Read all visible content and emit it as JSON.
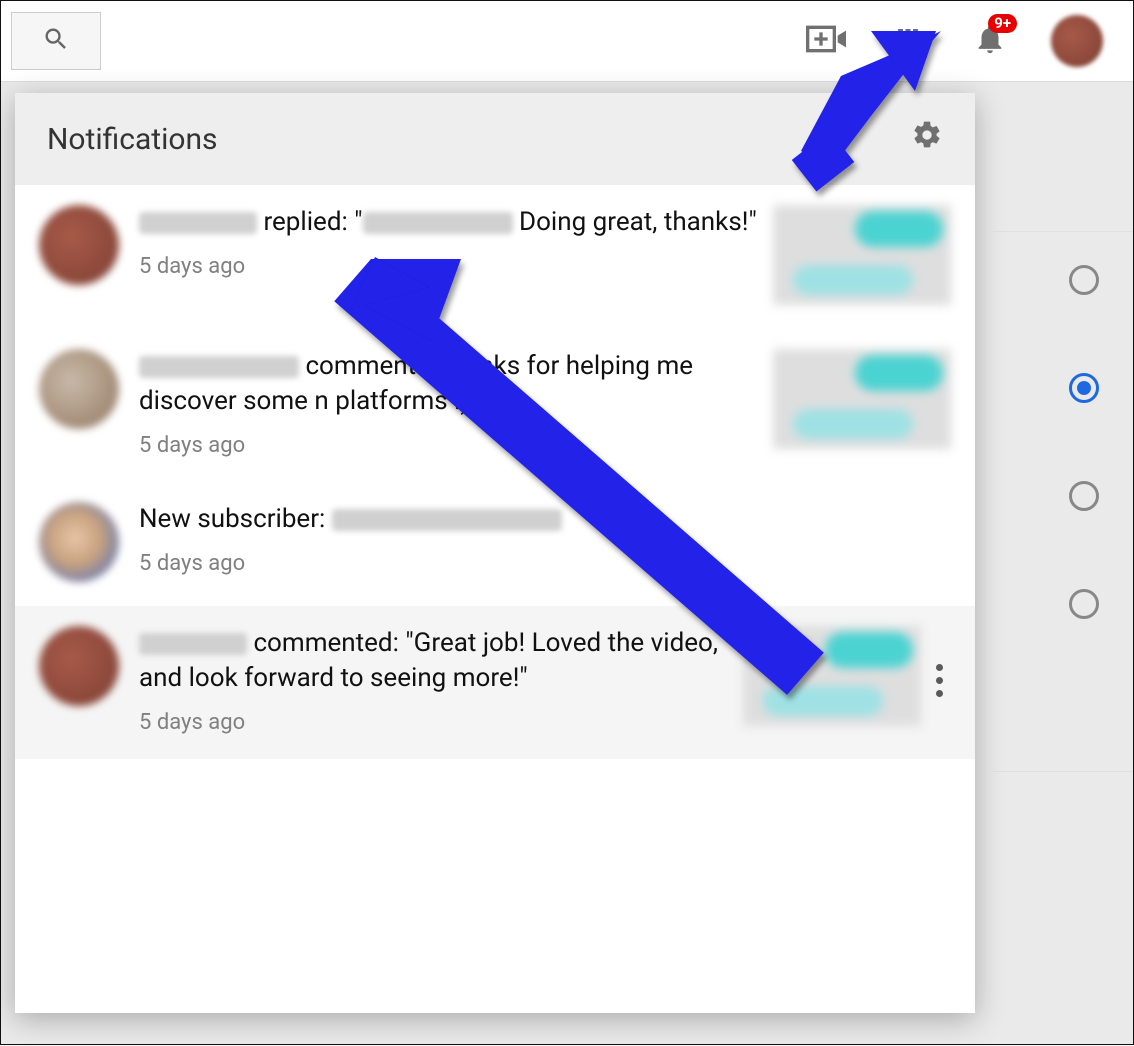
{
  "badge": "9+",
  "panel": {
    "title": "Notifications"
  },
  "side_radios": [
    {
      "selected": false
    },
    {
      "selected": true
    },
    {
      "selected": false
    },
    {
      "selected": false
    }
  ],
  "items": [
    {
      "redacted_name_width": 118,
      "text_before": " replied: \"",
      "redacted_inner_width": 150,
      "text_after": " Doing great, thanks!\"",
      "time": "5 days ago",
      "avatar": "av-red",
      "has_thumb": true,
      "hover": false
    },
    {
      "redacted_name_width": 160,
      "text_before": " commented: \"",
      "redacted_inner_width": 0,
      "text_after": "anks for helping me discover some n platforms :)\"",
      "time": "5 days ago",
      "avatar": "av-gray",
      "has_thumb": true,
      "hover": false
    },
    {
      "redacted_name_width": 0,
      "text_before": "New subscriber: ",
      "redacted_inner_width": 230,
      "text_after": "",
      "time": "5 days ago",
      "avatar": "av-blue",
      "has_thumb": false,
      "hover": false
    },
    {
      "redacted_name_width": 108,
      "text_before": " commented: \"Great job! Loved the video, and look forward to seeing more!\"",
      "redacted_inner_width": 0,
      "text_after": "",
      "time": "5 days ago",
      "avatar": "av-red",
      "has_thumb": true,
      "hover": true
    }
  ]
}
